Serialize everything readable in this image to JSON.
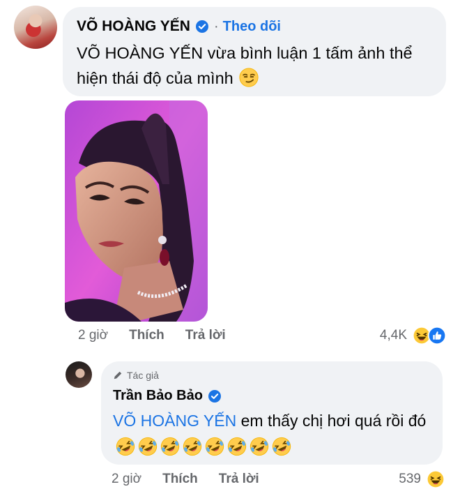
{
  "comment": {
    "author": "VÕ HOÀNG YẾN",
    "follow_separator": "·",
    "follow_label": "Theo dõi",
    "text": "VÕ HOÀNG YẾN vừa bình luận 1 tấm ảnh thể hiện thái độ của mình",
    "emoji": "smirk-emoji",
    "photo": "woman-portrait-photo",
    "time": "2 giờ",
    "like_label": "Thích",
    "reply_label": "Trả lời",
    "reaction_count": "4,4K",
    "reaction_icons": [
      "haha-icon",
      "like-icon"
    ]
  },
  "reply": {
    "badge_label": "Tác giả",
    "author": "Trần Bảo Bảo",
    "mention": "VÕ HOÀNG YẾN",
    "text": " em thấy chị hơi quá rồi đó ",
    "emoji_count": 8,
    "emoji": "rofl-emoji",
    "time": "2 giờ",
    "like_label": "Thích",
    "reply_label": "Trả lời",
    "reaction_count": "539",
    "reaction_icons": [
      "haha-icon"
    ]
  },
  "colors": {
    "bubble": "#f0f2f5",
    "link": "#1b74e4",
    "muted": "#65676b",
    "text": "#050505"
  }
}
